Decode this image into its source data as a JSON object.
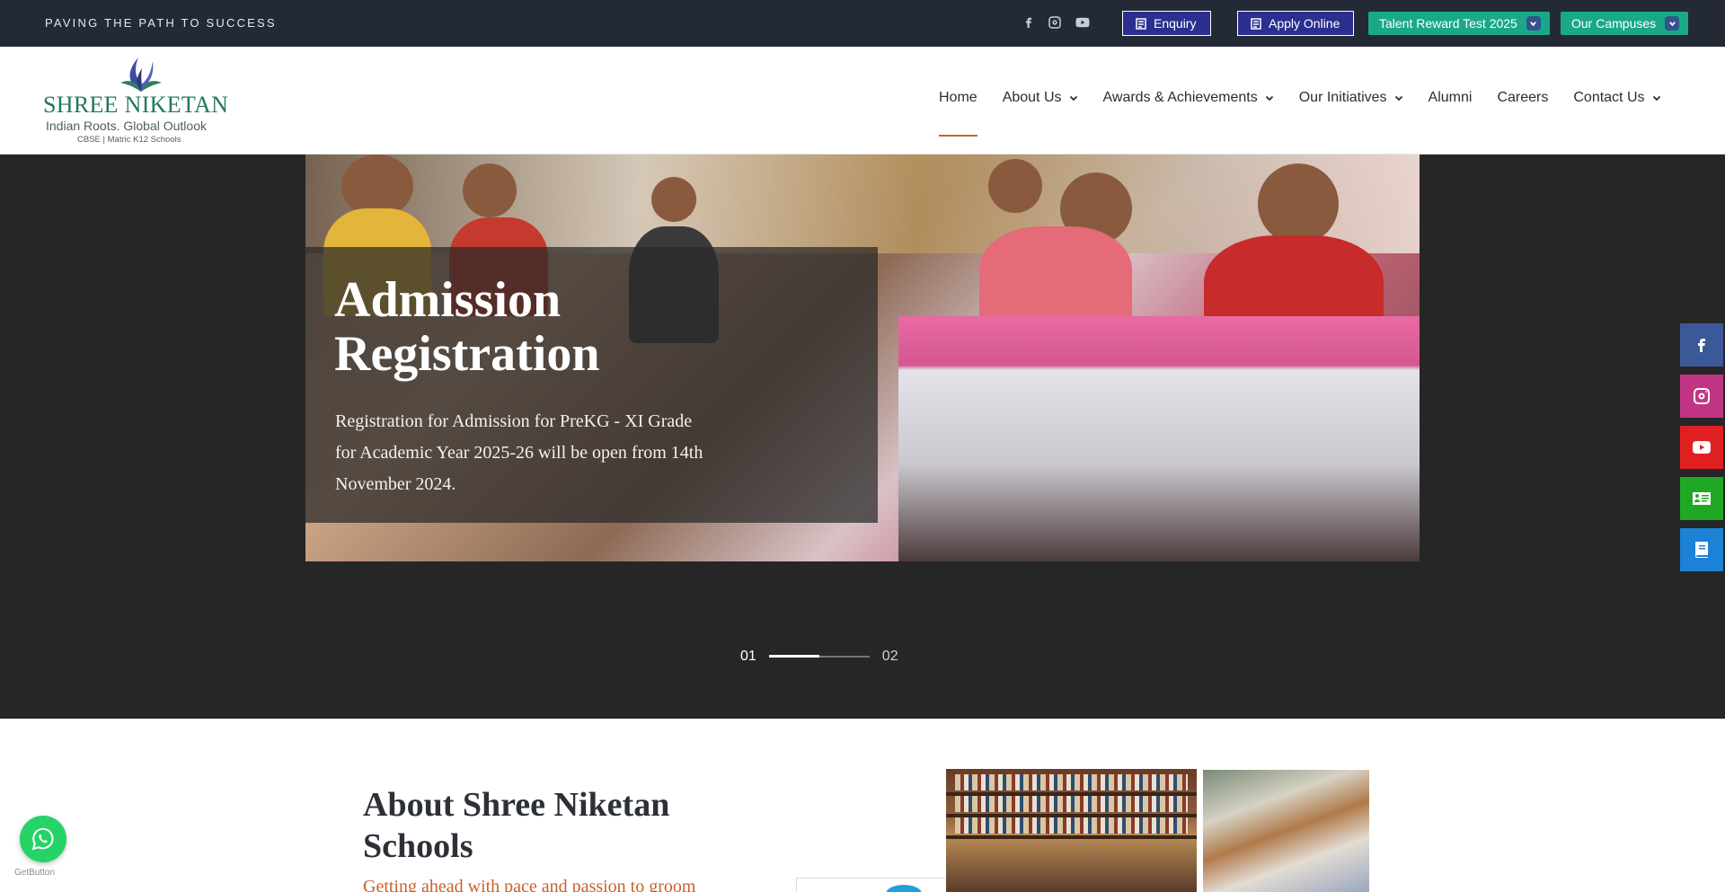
{
  "topbar": {
    "tagline": "PAVING THE PATH TO SUCCESS",
    "social_icons": [
      "facebook-icon",
      "instagram-icon",
      "youtube-icon"
    ],
    "enquiry_label": "Enquiry",
    "apply_label": "Apply Online",
    "talent_label": "Talent Reward Test 2025",
    "campuses_label": "Our Campuses"
  },
  "header": {
    "logo": {
      "name": "SHREE NIKETAN",
      "tagline": "Indian Roots. Global Outlook",
      "sub": "CBSE | Matric K12 Schools"
    },
    "nav": [
      {
        "label": "Home",
        "active": true
      },
      {
        "label": "About Us",
        "dropdown": true
      },
      {
        "label": "Awards & Achievements",
        "dropdown": true
      },
      {
        "label": "Our Initiatives",
        "dropdown": true
      },
      {
        "label": "Alumni"
      },
      {
        "label": "Careers"
      },
      {
        "label": "Contact Us",
        "dropdown": true
      }
    ]
  },
  "hero": {
    "title": "Admission Registration",
    "text": "Registration for Admission for PreKG - XI Grade for Academic Year 2025-26 will be open from 14th November 2024.",
    "pager": {
      "current": "01",
      "next": "02"
    }
  },
  "side_social": [
    {
      "icon": "facebook-icon",
      "color": "#3b5998"
    },
    {
      "icon": "instagram-icon",
      "color": "#c13584"
    },
    {
      "icon": "youtube-icon",
      "color": "#e02020"
    },
    {
      "icon": "contact-card-icon",
      "color": "#1fa824"
    },
    {
      "icon": "book-icon",
      "color": "#1b82d6"
    }
  ],
  "about": {
    "title": "About Shree Niketan Schools",
    "subtitle": "Getting ahead with pace and passion to groom"
  },
  "whatsapp": {
    "credit": "GetButton"
  },
  "colors": {
    "topbar_bg": "#232a36",
    "button_blue": "#2b2f8f",
    "button_green": "#19a989",
    "accent_orange": "#c9602b",
    "hero_bg": "#262626"
  }
}
